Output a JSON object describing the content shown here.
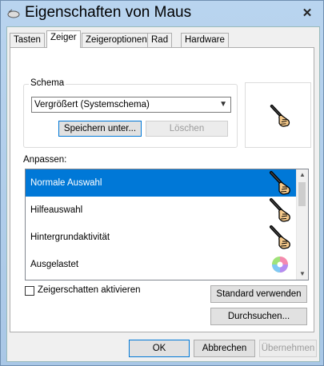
{
  "window": {
    "title": "Eigenschaften von Maus",
    "close_label": "✕"
  },
  "tabs": [
    {
      "label": "Tasten",
      "active": false
    },
    {
      "label": "Zeiger",
      "active": true
    },
    {
      "label": "Zeigeroptionen",
      "active": false
    },
    {
      "label": "Rad",
      "active": false
    },
    {
      "label": "Hardware",
      "active": false
    }
  ],
  "scheme": {
    "group_label": "Schema",
    "selected": "Vergrößert (Systemschema)",
    "save_label": "Speichern unter...",
    "delete_label": "Löschen"
  },
  "customize": {
    "label": "Anpassen:",
    "items": [
      {
        "label": "Normale Auswahl",
        "icon": "hand-pen-cursor-icon",
        "selected": true
      },
      {
        "label": "Hilfeauswahl",
        "icon": "hand-pen-cursor-icon",
        "selected": false
      },
      {
        "label": "Hintergrundaktivität",
        "icon": "hand-pen-cursor-icon",
        "selected": false
      },
      {
        "label": "Ausgelastet",
        "icon": "busy-spinner-icon",
        "selected": false
      }
    ]
  },
  "options": {
    "shadow_label": "Zeigerschatten aktivieren",
    "shadow_checked": false,
    "default_label": "Standard verwenden",
    "browse_label": "Durchsuchen..."
  },
  "footer": {
    "ok_label": "OK",
    "cancel_label": "Abbrechen",
    "apply_label": "Übernehmen"
  },
  "colors": {
    "accent": "#0078d7",
    "title_bar": "#b9d4ef"
  }
}
